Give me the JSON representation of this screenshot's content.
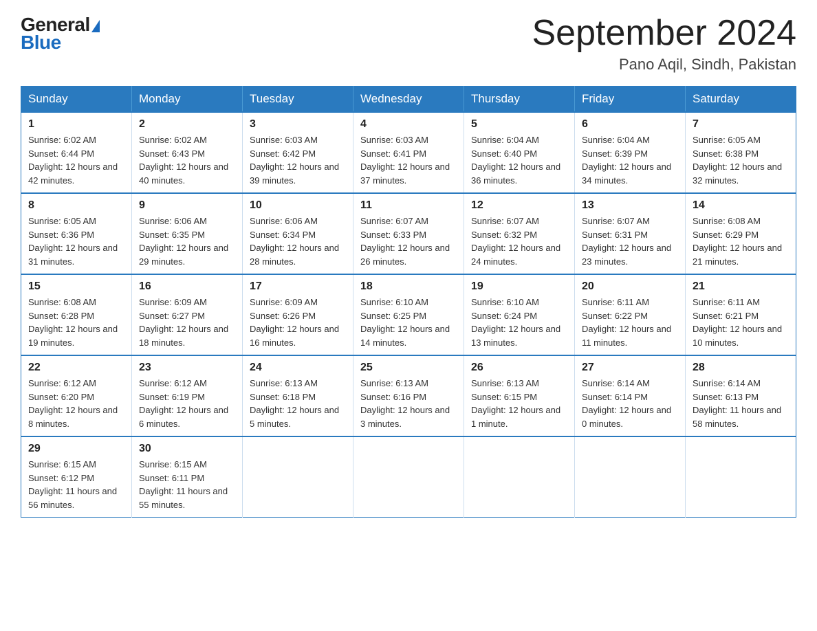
{
  "header": {
    "logo_general": "General",
    "logo_blue": "Blue",
    "month_title": "September 2024",
    "location": "Pano Aqil, Sindh, Pakistan"
  },
  "days_of_week": [
    "Sunday",
    "Monday",
    "Tuesday",
    "Wednesday",
    "Thursday",
    "Friday",
    "Saturday"
  ],
  "weeks": [
    [
      {
        "day": "1",
        "sunrise": "6:02 AM",
        "sunset": "6:44 PM",
        "daylight": "12 hours and 42 minutes."
      },
      {
        "day": "2",
        "sunrise": "6:02 AM",
        "sunset": "6:43 PM",
        "daylight": "12 hours and 40 minutes."
      },
      {
        "day": "3",
        "sunrise": "6:03 AM",
        "sunset": "6:42 PM",
        "daylight": "12 hours and 39 minutes."
      },
      {
        "day": "4",
        "sunrise": "6:03 AM",
        "sunset": "6:41 PM",
        "daylight": "12 hours and 37 minutes."
      },
      {
        "day": "5",
        "sunrise": "6:04 AM",
        "sunset": "6:40 PM",
        "daylight": "12 hours and 36 minutes."
      },
      {
        "day": "6",
        "sunrise": "6:04 AM",
        "sunset": "6:39 PM",
        "daylight": "12 hours and 34 minutes."
      },
      {
        "day": "7",
        "sunrise": "6:05 AM",
        "sunset": "6:38 PM",
        "daylight": "12 hours and 32 minutes."
      }
    ],
    [
      {
        "day": "8",
        "sunrise": "6:05 AM",
        "sunset": "6:36 PM",
        "daylight": "12 hours and 31 minutes."
      },
      {
        "day": "9",
        "sunrise": "6:06 AM",
        "sunset": "6:35 PM",
        "daylight": "12 hours and 29 minutes."
      },
      {
        "day": "10",
        "sunrise": "6:06 AM",
        "sunset": "6:34 PM",
        "daylight": "12 hours and 28 minutes."
      },
      {
        "day": "11",
        "sunrise": "6:07 AM",
        "sunset": "6:33 PM",
        "daylight": "12 hours and 26 minutes."
      },
      {
        "day": "12",
        "sunrise": "6:07 AM",
        "sunset": "6:32 PM",
        "daylight": "12 hours and 24 minutes."
      },
      {
        "day": "13",
        "sunrise": "6:07 AM",
        "sunset": "6:31 PM",
        "daylight": "12 hours and 23 minutes."
      },
      {
        "day": "14",
        "sunrise": "6:08 AM",
        "sunset": "6:29 PM",
        "daylight": "12 hours and 21 minutes."
      }
    ],
    [
      {
        "day": "15",
        "sunrise": "6:08 AM",
        "sunset": "6:28 PM",
        "daylight": "12 hours and 19 minutes."
      },
      {
        "day": "16",
        "sunrise": "6:09 AM",
        "sunset": "6:27 PM",
        "daylight": "12 hours and 18 minutes."
      },
      {
        "day": "17",
        "sunrise": "6:09 AM",
        "sunset": "6:26 PM",
        "daylight": "12 hours and 16 minutes."
      },
      {
        "day": "18",
        "sunrise": "6:10 AM",
        "sunset": "6:25 PM",
        "daylight": "12 hours and 14 minutes."
      },
      {
        "day": "19",
        "sunrise": "6:10 AM",
        "sunset": "6:24 PM",
        "daylight": "12 hours and 13 minutes."
      },
      {
        "day": "20",
        "sunrise": "6:11 AM",
        "sunset": "6:22 PM",
        "daylight": "12 hours and 11 minutes."
      },
      {
        "day": "21",
        "sunrise": "6:11 AM",
        "sunset": "6:21 PM",
        "daylight": "12 hours and 10 minutes."
      }
    ],
    [
      {
        "day": "22",
        "sunrise": "6:12 AM",
        "sunset": "6:20 PM",
        "daylight": "12 hours and 8 minutes."
      },
      {
        "day": "23",
        "sunrise": "6:12 AM",
        "sunset": "6:19 PM",
        "daylight": "12 hours and 6 minutes."
      },
      {
        "day": "24",
        "sunrise": "6:13 AM",
        "sunset": "6:18 PM",
        "daylight": "12 hours and 5 minutes."
      },
      {
        "day": "25",
        "sunrise": "6:13 AM",
        "sunset": "6:16 PM",
        "daylight": "12 hours and 3 minutes."
      },
      {
        "day": "26",
        "sunrise": "6:13 AM",
        "sunset": "6:15 PM",
        "daylight": "12 hours and 1 minute."
      },
      {
        "day": "27",
        "sunrise": "6:14 AM",
        "sunset": "6:14 PM",
        "daylight": "12 hours and 0 minutes."
      },
      {
        "day": "28",
        "sunrise": "6:14 AM",
        "sunset": "6:13 PM",
        "daylight": "11 hours and 58 minutes."
      }
    ],
    [
      {
        "day": "29",
        "sunrise": "6:15 AM",
        "sunset": "6:12 PM",
        "daylight": "11 hours and 56 minutes."
      },
      {
        "day": "30",
        "sunrise": "6:15 AM",
        "sunset": "6:11 PM",
        "daylight": "11 hours and 55 minutes."
      },
      null,
      null,
      null,
      null,
      null
    ]
  ]
}
